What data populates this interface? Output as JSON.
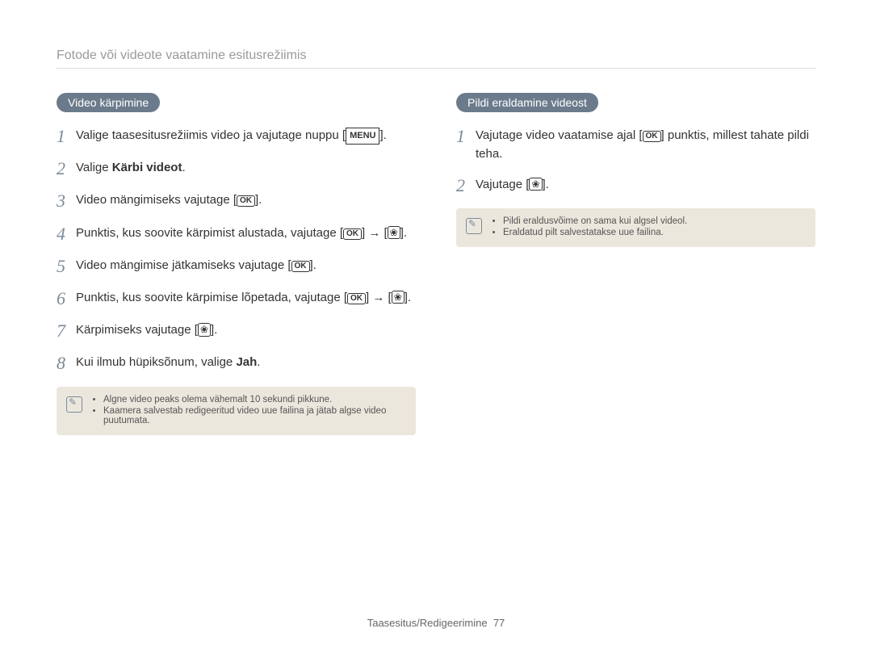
{
  "breadcrumb": "Fotode või videote vaatamine esitusrežiimis",
  "left": {
    "heading": "Video kärpimine",
    "steps": [
      {
        "n": "1",
        "pre": "Valige taasesitusrežiimis video ja vajutage nuppu [",
        "icon": "menu",
        "post": "]."
      },
      {
        "n": "2",
        "pre": "Valige ",
        "bold": "Kärbi videot",
        "post": "."
      },
      {
        "n": "3",
        "pre": "Video mängimiseks vajutage [",
        "icon": "ok",
        "post": "]."
      },
      {
        "n": "4",
        "pre": "Punktis, kus soovite kärpimist alustada, vajutage [",
        "icon": "ok",
        "mid": "] → [",
        "icon2": "flower",
        "post": "]."
      },
      {
        "n": "5",
        "pre": "Video mängimise jätkamiseks vajutage [",
        "icon": "ok",
        "post": "]."
      },
      {
        "n": "6",
        "pre": "Punktis, kus soovite kärpimise lõpetada, vajutage [",
        "icon": "ok",
        "mid": "] → [",
        "icon2": "flower",
        "post": "]."
      },
      {
        "n": "7",
        "pre": "Kärpimiseks vajutage [",
        "icon": "flower",
        "post": "]."
      },
      {
        "n": "8",
        "pre": "Kui ilmub hüpiksõnum, valige ",
        "bold": "Jah",
        "post": "."
      }
    ],
    "notes": [
      "Algne video peaks olema vähemalt 10 sekundi pikkune.",
      "Kaamera salvestab redigeeritud video uue failina ja jätab algse video puutumata."
    ]
  },
  "right": {
    "heading": "Pildi eraldamine videost",
    "steps": [
      {
        "n": "1",
        "pre": "Vajutage video vaatamise ajal [",
        "icon": "ok",
        "post": "] punktis, millest tahate pildi teha."
      },
      {
        "n": "2",
        "pre": "Vajutage [",
        "icon": "flower",
        "post": "]."
      }
    ],
    "notes": [
      "Pildi eraldusvõime on sama kui algsel videol.",
      "Eraldatud pilt salvestatakse uue failina."
    ]
  },
  "footer_label": "Taasesitus/Redigeerimine",
  "footer_page": "77",
  "icons": {
    "ok": "OK",
    "menu": "MENU",
    "flower": "❀"
  }
}
